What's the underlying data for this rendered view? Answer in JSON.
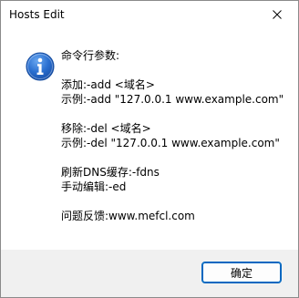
{
  "window": {
    "title": "Hosts Edit"
  },
  "icons": {
    "info": "info-icon",
    "close": "close-icon"
  },
  "message": {
    "lines": [
      "命令行参数:",
      "",
      "添加:-add <域名>",
      "示例:-add \"127.0.0.1  www.example.com\"",
      "",
      "移除:-del <域名>",
      "示例:-del \"127.0.0.1  www.example.com\"",
      "",
      "刷新DNS缓存:-fdns",
      "手动编辑:-ed",
      "",
      "问题反馈:www.mefcl.com"
    ]
  },
  "buttons": {
    "ok_label": "确定"
  },
  "colors": {
    "accent": "#0067c0",
    "info_icon": "#1f63c6",
    "footer_bg": "#f0f0f0"
  }
}
